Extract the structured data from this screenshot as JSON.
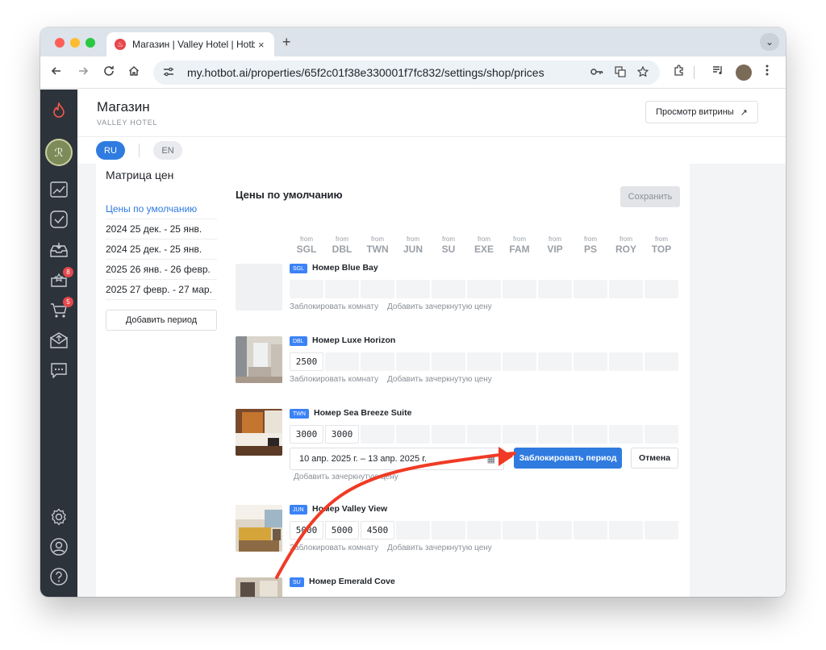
{
  "browser": {
    "tab_title": "Магазин | Valley Hotel | Hotbot",
    "tab_close": "×",
    "new_tab": "+",
    "tab_menu": "⌄",
    "url": "my.hotbot.ai/properties/65f2c01f38e330001f7fc832/settings/shop/prices",
    "favicon_glyph": "♨",
    "icons": [
      "back-icon",
      "forward-icon",
      "reload-icon",
      "home-icon",
      "tune-icon",
      "key-icon",
      "translate-icon",
      "star-icon",
      "extensions-icon",
      "media-icon",
      "profile-avatar",
      "more-icon"
    ]
  },
  "sidebar": {
    "badges": {
      "reviews": "8",
      "cart": "5"
    },
    "property_initial": "ℛ"
  },
  "header": {
    "title": "Магазин",
    "subtitle": "VALLEY HOTEL",
    "storefront_button": "Просмотр витрины",
    "storefront_arrow": "↗"
  },
  "languages": {
    "ru": "RU",
    "en": "EN"
  },
  "panel": {
    "title": "Матрица цен",
    "periods": [
      "Цены по умолчанию",
      "2024 25 дек. - 25 янв.",
      "2024 25 дек. - 25 янв.",
      "2025 26 янв. - 26 февр.",
      "2025 27 февр. - 27 мар."
    ],
    "add_period": "Добавить период"
  },
  "matrix": {
    "title": "Цены по умолчанию",
    "save_button": "Сохранить",
    "from_label": "from",
    "columns": [
      "SGL",
      "DBL",
      "TWN",
      "JUN",
      "SU",
      "EXE",
      "FAM",
      "VIP",
      "PS",
      "ROY",
      "TOP"
    ],
    "block_room_link": "Заблокировать комнату",
    "strike_price_link": "Добавить зачеркнутую цену",
    "rooms": [
      {
        "badge": "SGL",
        "name": "Номер Blue Bay",
        "prices": [
          "",
          "",
          "",
          "",
          "",
          "",
          "",
          "",
          "",
          "",
          ""
        ]
      },
      {
        "badge": "DBL",
        "name": "Номер Luxe Horizon",
        "prices": [
          "2500",
          "",
          "",
          "",
          "",
          "",
          "",
          "",
          "",
          "",
          ""
        ]
      },
      {
        "badge": "TWN",
        "name": "Номер Sea Breeze Suite",
        "prices": [
          "3000",
          "3000",
          "",
          "",
          "",
          "",
          "",
          "",
          "",
          "",
          ""
        ]
      },
      {
        "badge": "JUN",
        "name": "Номер Valley View",
        "prices": [
          "5000",
          "5000",
          "4500",
          "",
          "",
          "",
          "",
          "",
          "",
          "",
          ""
        ]
      },
      {
        "badge": "SU",
        "name": "Номер Emerald Cove",
        "prices": []
      }
    ],
    "block_form": {
      "date_range": "10 апр. 2025 г. – 13 апр. 2025 г.",
      "calendar_glyph": "▦",
      "block_button": "Заблокировать период",
      "cancel_button": "Отмена"
    }
  },
  "colors": {
    "accent": "#2f7be0",
    "sidebar": "#2d333b",
    "annotation_arrow": "#f03a25",
    "badge": "#e5484d"
  }
}
